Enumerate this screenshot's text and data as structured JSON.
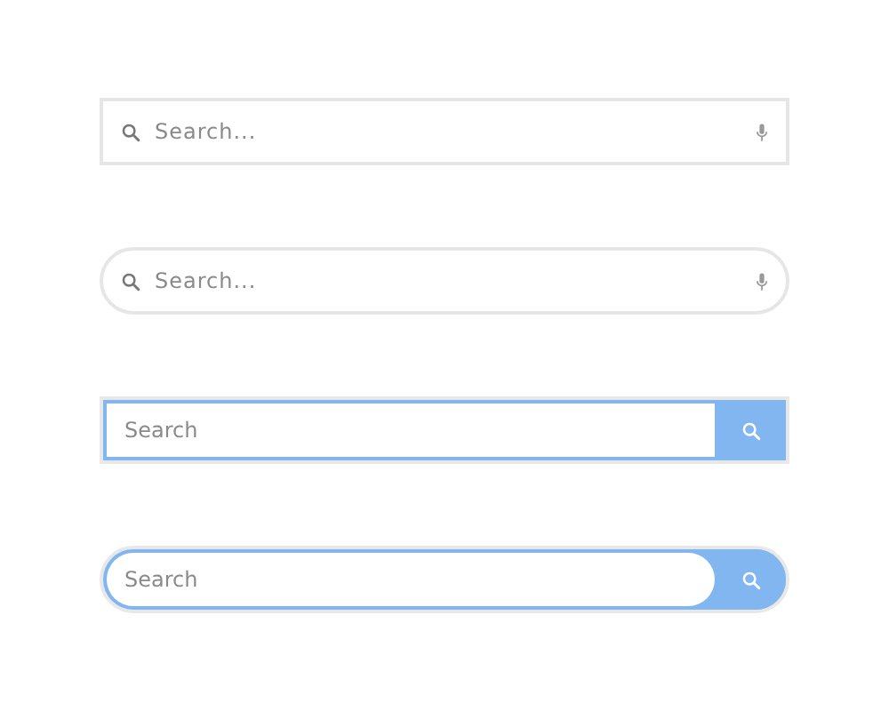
{
  "search_bars": [
    {
      "kind": "mic",
      "rounded": false,
      "placeholder": "Search..."
    },
    {
      "kind": "mic",
      "rounded": true,
      "placeholder": "Search..."
    },
    {
      "kind": "button",
      "rounded": false,
      "placeholder": "Search"
    },
    {
      "kind": "button",
      "rounded": true,
      "placeholder": "Search"
    }
  ]
}
